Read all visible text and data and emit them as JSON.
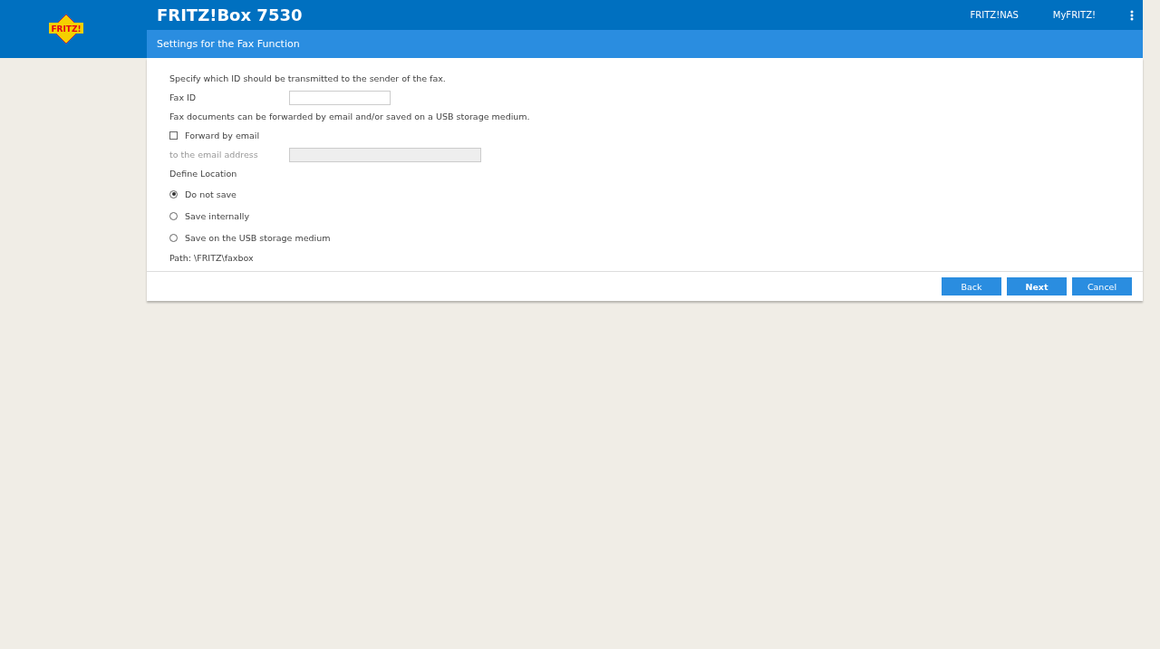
{
  "header": {
    "logo_text": "FRITZ!",
    "title": "FRITZ!Box 7530",
    "links": [
      "FRITZ!NAS",
      "MyFRITZ!"
    ]
  },
  "page_title": "Settings for the Fax Function",
  "form": {
    "intro": "Specify which ID should be transmitted to the sender of the fax.",
    "fax_id": {
      "label": "Fax ID"
    },
    "forward_note": "Fax documents can be forwarded by email and/or saved on a USB storage medium.",
    "forward_email": {
      "label": "Forward by email",
      "checked": false
    },
    "email_address": {
      "label": "to the email address",
      "disabled": true
    },
    "location_heading": "Define Location",
    "locations": [
      {
        "label": "Do not save",
        "selected": true
      },
      {
        "label": "Save internally",
        "selected": false
      },
      {
        "label": "Save on the USB storage medium",
        "selected": false
      }
    ],
    "path": "Path: \\FRITZ\\faxbox"
  },
  "buttons": [
    {
      "label": "Back",
      "primary": false
    },
    {
      "label": "Next",
      "primary": true
    },
    {
      "label": "Cancel",
      "primary": false
    }
  ]
}
